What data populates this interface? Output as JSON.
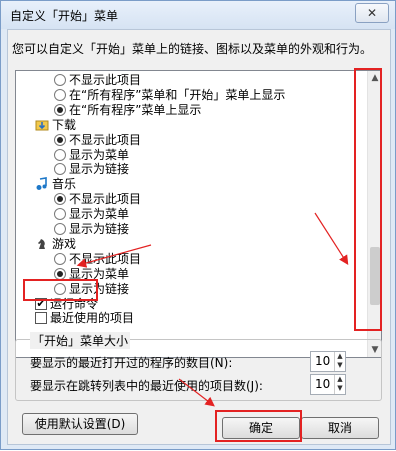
{
  "window": {
    "title": "自定义「开始」菜单",
    "close_glyph": "✕",
    "description": "您可以自定义「开始」菜单上的链接、图标以及菜单的外观和行为。"
  },
  "list": {
    "items": [
      {
        "type": "radio",
        "label": "不显示此项目",
        "checked": false
      },
      {
        "type": "radio",
        "label": "在“所有程序”菜单和「开始」菜单上显示",
        "checked": false
      },
      {
        "type": "radio",
        "label": "在“所有程序”菜单上显示",
        "checked": true
      },
      {
        "type": "header",
        "label": "下载",
        "icon": "download-folder-icon"
      },
      {
        "type": "radio",
        "label": "不显示此项目",
        "checked": true
      },
      {
        "type": "radio",
        "label": "显示为菜单",
        "checked": false
      },
      {
        "type": "radio",
        "label": "显示为链接",
        "checked": false
      },
      {
        "type": "header",
        "label": "音乐",
        "icon": "music-note-icon"
      },
      {
        "type": "radio",
        "label": "不显示此项目",
        "checked": true
      },
      {
        "type": "radio",
        "label": "显示为菜单",
        "checked": false
      },
      {
        "type": "radio",
        "label": "显示为链接",
        "checked": false
      },
      {
        "type": "header",
        "label": "游戏",
        "icon": "games-icon"
      },
      {
        "type": "radio",
        "label": "不显示此项目",
        "checked": false
      },
      {
        "type": "radio",
        "label": "显示为菜单",
        "checked": true
      },
      {
        "type": "radio",
        "label": "显示为链接",
        "checked": false
      },
      {
        "type": "checkbox",
        "label": "运行命令",
        "checked": true
      },
      {
        "type": "checkbox",
        "label": "最近使用的项目",
        "checked": false
      }
    ]
  },
  "menu_size": {
    "group_label": "「开始」菜单大小",
    "recent_programs_label": "要显示的最近打开过的程序的数目(N):",
    "recent_programs_value": "10",
    "jump_list_label": "要显示在跳转列表中的最近使用的项目数(J):",
    "jump_list_value": "10"
  },
  "buttons": {
    "defaults": "使用默认设置(D)",
    "ok": "确定",
    "cancel": "取消"
  },
  "colors": {
    "annotation": "#e32222"
  }
}
